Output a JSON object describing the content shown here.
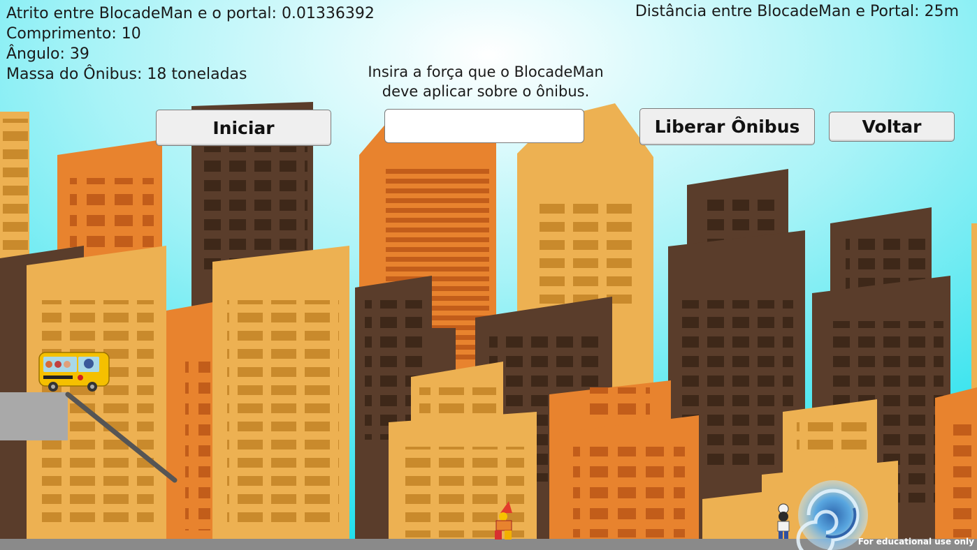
{
  "hud": {
    "friction_line": "Atrito entre BlocadeMan e o portal: 0.01336392",
    "length_line": "Comprimento: 10",
    "angle_line": "Ângulo: 39",
    "mass_line": "Massa do Ônibus: 18 toneladas",
    "distance_line": "Distância entre BlocadeMan e Portal: 25m"
  },
  "prompt": {
    "line1": "Insira a força que o BlocadeMan",
    "line2": "deve aplicar sobre o ônibus."
  },
  "controls": {
    "start_label": "Iniciar",
    "force_value": "",
    "release_label": "Liberar Ônibus",
    "back_label": "Voltar"
  },
  "watermark": "For educational use only",
  "colors": {
    "sky": "#27e3ee",
    "building_orange": "#e8832e",
    "building_yellow": "#edb152",
    "building_brown": "#5a3d2b",
    "ground": "#8a8a8a",
    "ramp": "#555555",
    "platform": "#a9a9a9",
    "bus": "#f5c000",
    "portal": "#3a8fe6"
  },
  "sprites": {
    "bus": "school-bus-icon",
    "ramp": "ramp",
    "hero": "blocademan-character",
    "villain": "clown-character",
    "portal": "swirl-portal-icon"
  }
}
